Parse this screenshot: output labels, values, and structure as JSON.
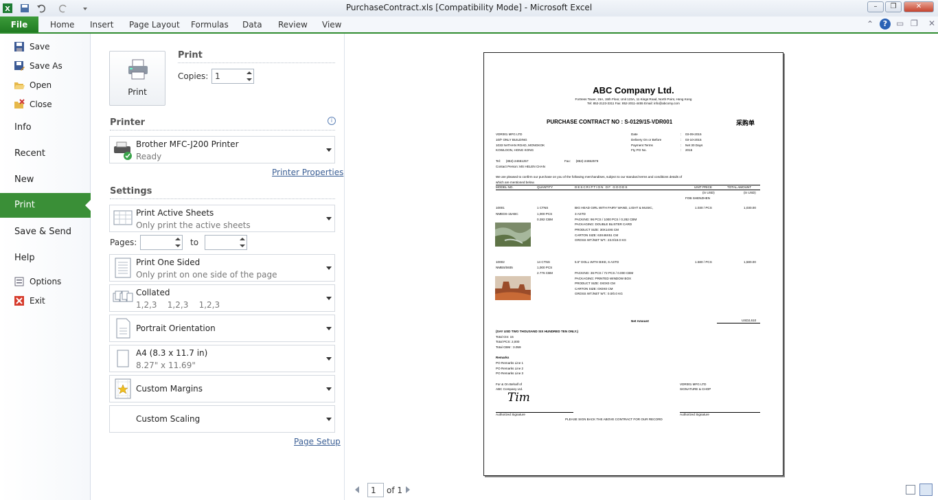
{
  "window": {
    "title": "PurchaseContract.xls  [Compatibility Mode]  -  Microsoft Excel"
  },
  "ribbon": {
    "file_tab": "File",
    "tabs": [
      "Home",
      "Insert",
      "Page Layout",
      "Formulas",
      "Data",
      "Review",
      "View"
    ]
  },
  "nav": {
    "save": "Save",
    "save_as": "Save As",
    "open": "Open",
    "close": "Close",
    "info": "Info",
    "recent": "Recent",
    "new": "New",
    "print": "Print",
    "save_send": "Save & Send",
    "help": "Help",
    "options": "Options",
    "exit": "Exit"
  },
  "print_panel": {
    "print_button": "Print",
    "print_heading": "Print",
    "copies_label": "Copies:",
    "copies_value": "1",
    "printer_heading": "Printer",
    "printer_name": "Brother MFC-J200 Printer",
    "printer_status": "Ready",
    "printer_properties": "Printer Properties",
    "settings_heading": "Settings",
    "print_what": "Print Active Sheets",
    "print_what_desc": "Only print the active sheets",
    "pages_label": "Pages:",
    "pages_to": "to",
    "sides": "Print One Sided",
    "sides_desc": "Only print on one side of the page",
    "collation": "Collated",
    "collation_desc": "1,2,3    1,2,3    1,2,3",
    "orientation": "Portrait Orientation",
    "paper": "A4 (8.3 x 11.7 in)",
    "paper_desc": "8.27\" x 11.69\"",
    "margins": "Custom Margins",
    "scaling": "Custom Scaling",
    "page_setup": "Page Setup"
  },
  "preview": {
    "current_page": "1",
    "of_pages": "of 1"
  },
  "document": {
    "company": "ABC Company Ltd.",
    "address1": "Fortress Tower, 15A, 15th Floor, Unit 123A, 11 Kings Road, North Point, Hong Kong",
    "address2": "Tel: 852-2123-3311    Fax: 852-2011-4455   Email: info@abcomy.com",
    "title": "PURCHASE CONTRACT NO :  S-0129/15-VDR001",
    "title_cn": "采购单",
    "vendor": [
      "VDR001 MFG LTD",
      "10/F ONLY BUILDING",
      "1033 NATHAN ROAD, MONGKOK",
      "KOWLOON, HONG KONG"
    ],
    "info_labels": [
      "Date",
      "Delivery On or Before",
      "Payment Terms",
      "Fty PO No."
    ],
    "info_values": [
      "03-09-2015",
      "03-10-2015",
      "Net 30 Days",
      "2015"
    ],
    "tel": "Tel:      (852)-24651257",
    "fax": "Fax:      (852)-24652579",
    "contact": "Contact Person: MS HELEN CHAN",
    "intro1": "We are pleased to confirm our purchase on you of the following merchandises, subject to our standard terms and conditions details of",
    "intro2": "which are mentioned below.",
    "col_model": "MODEL NO.",
    "col_qty": "QUANTITY",
    "col_desc": "DESCRIPTION  OF  GOODS",
    "col_unit": "UNIT PRICE",
    "col_unit2": "(in USD)",
    "col_unit3": "FOB SHENZHEN",
    "col_total": "TOTAL AMOUNT",
    "col_total2": "(in USD)",
    "items": [
      {
        "model": "10001",
        "model2": "NMEDS-15ABC",
        "qty": "1 CTNS",
        "qty2": "1,000 PCS",
        "qty3": "0.282 CBM",
        "desc": "BIG HEAD GIRL WITH FAIRY WAND, LIGHT & MUSIC,",
        "desc2": "3 ASTD",
        "d3": "PACKING: 96 PCS / 1000 PCS  /  0.282 CBM",
        "d4": "PACKAGING: DOUBLE BLISTER CARD",
        "d5": "PRODUCT SIZE: 30X14X6 CM",
        "d6": "CARTON SIZE: 63X46X51 CM",
        "d7": "GROSS WT./NET WT.: 23.0/19.0 KG",
        "unit": "1.030 / PCS",
        "total": "1,030.00"
      },
      {
        "model": "10002",
        "model2": "NMBS/5935",
        "qty": "14 CTNS",
        "qty2": "1,000 PCS",
        "qty3": "2.776 CBM",
        "desc": "5.5\" DOLL WITH BIKE, 6 ASTD",
        "desc2": "",
        "d3": "PACKING: 36 PCS / 72 PCS  /  0.000 CBM",
        "d4": "PACKAGING: PRINTED WINDOW BOX",
        "d5": "PRODUCT SIZE: 0X0X0 CM",
        "d6": "CARTON SIZE: 0X0X0 CM",
        "d7": "GROSS WT./NET WT.: 0.0/0.0 KG",
        "unit": "1.580 / PCS",
        "total": "1,580.00"
      }
    ],
    "net_label": "Net Amount",
    "net_value": "USD2,610",
    "say": "(SAY USD TWO THOUSAND SIX HUNDRED TEN ONLY.)",
    "totals": [
      "Total Ctn: 15",
      "Total PCS: 2,000",
      "Total CBM : 3.059"
    ],
    "remarks_label": "Remarks",
    "remarks": [
      "PO Remarks Line 1",
      "PO Remarks Line 2",
      "PO Remarks Line 3"
    ],
    "behalf1": "For & On Behalf of",
    "behalf2": "ABC Company Ltd.",
    "vendor_sig1": "VDR001 MFG LTD",
    "vendor_sig2": "SIGNATURE & CHOP",
    "signature": "Tim",
    "auth_sig": "Authorized Signature",
    "auth_sig2": "Authorized Signature",
    "footer": "PLEASE SIGN BACK THE ABOVE CONTRACT FOR OUR RECORD"
  }
}
